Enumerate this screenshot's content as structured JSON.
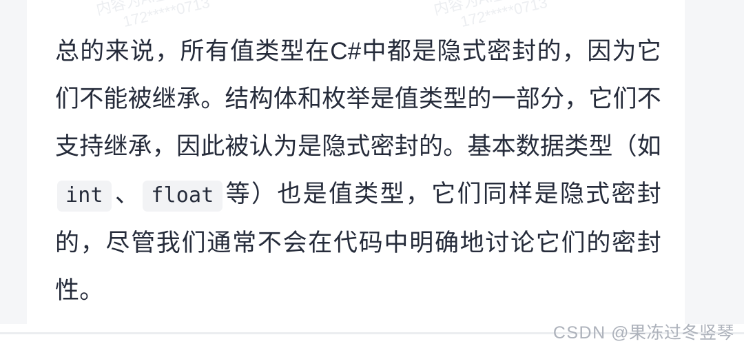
{
  "article": {
    "paragraph": {
      "segment_1": "总的来说，所有值类型在C#中都是隐式密封的，因为它们不能被继承。结构体和枚举是值类型的一部分，它们不支持继承，因此被认为是隐式密封的。基本数据类型（如",
      "code_1": "int",
      "segment_2": "、",
      "code_2": "float",
      "segment_3": "等）也是值类型，它们同样是隐式密封的，尽管我们通常不会在代码中明确地讨论它们的密封性。"
    },
    "lines": [
      "总的来说，所有值类型在C#中都是隐式密封的，",
      "因为它们不能被继承。结构体和枚举是值类型的一",
      "部分，它们不支持继承，因此被认为是隐式密封",
      "的。基本数据类型（如 int 、 float 等）也是值",
      "类型，它们同样是隐式密封的，尽管我们通常不会",
      "在代码中明确地讨论它们的密封性。"
    ]
  },
  "watermark": {
    "line1": "内容为AI生成",
    "line2": "172*****0713"
  },
  "footer": {
    "brand": "CSDN",
    "author": "@果冻过冬竖琴",
    "full": "CSDN @果冻过冬竖琴"
  },
  "colors": {
    "page_background": "#ffffff",
    "gutter": "#f5f6f8",
    "text": "#252b3a",
    "code_background": "#f2f3f5",
    "watermark": "#eceef1",
    "divider": "#ebedf0",
    "footer_text": "#adb2bb"
  }
}
